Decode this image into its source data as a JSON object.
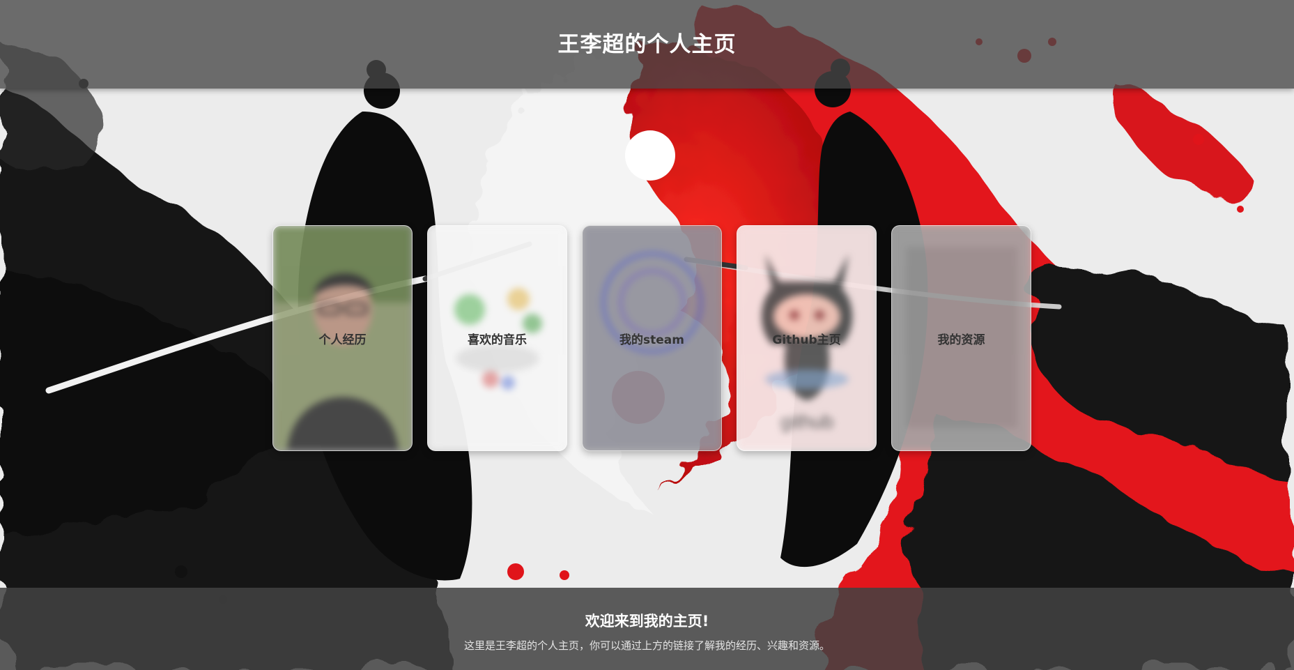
{
  "header": {
    "title": "王李超的个人主页"
  },
  "cards": [
    {
      "label": "个人经历",
      "icon": "portrait-photo"
    },
    {
      "label": "喜欢的音乐",
      "icon": "music-art"
    },
    {
      "label": "我的steam",
      "icon": "steam-art"
    },
    {
      "label": "Github主页",
      "icon": "github-octocat-icon"
    },
    {
      "label": "我的资源",
      "icon": "resources-art"
    }
  ],
  "footer": {
    "heading": "欢迎来到我的主页!",
    "description": "这里是王李超的个人主页，你可以通过上方的链接了解我的经历、兴趣和资源。"
  },
  "colors": {
    "accent_red": "#e0141a",
    "ink_black": "#141414",
    "header_bg": "#464646",
    "footer_bg": "#414141"
  }
}
